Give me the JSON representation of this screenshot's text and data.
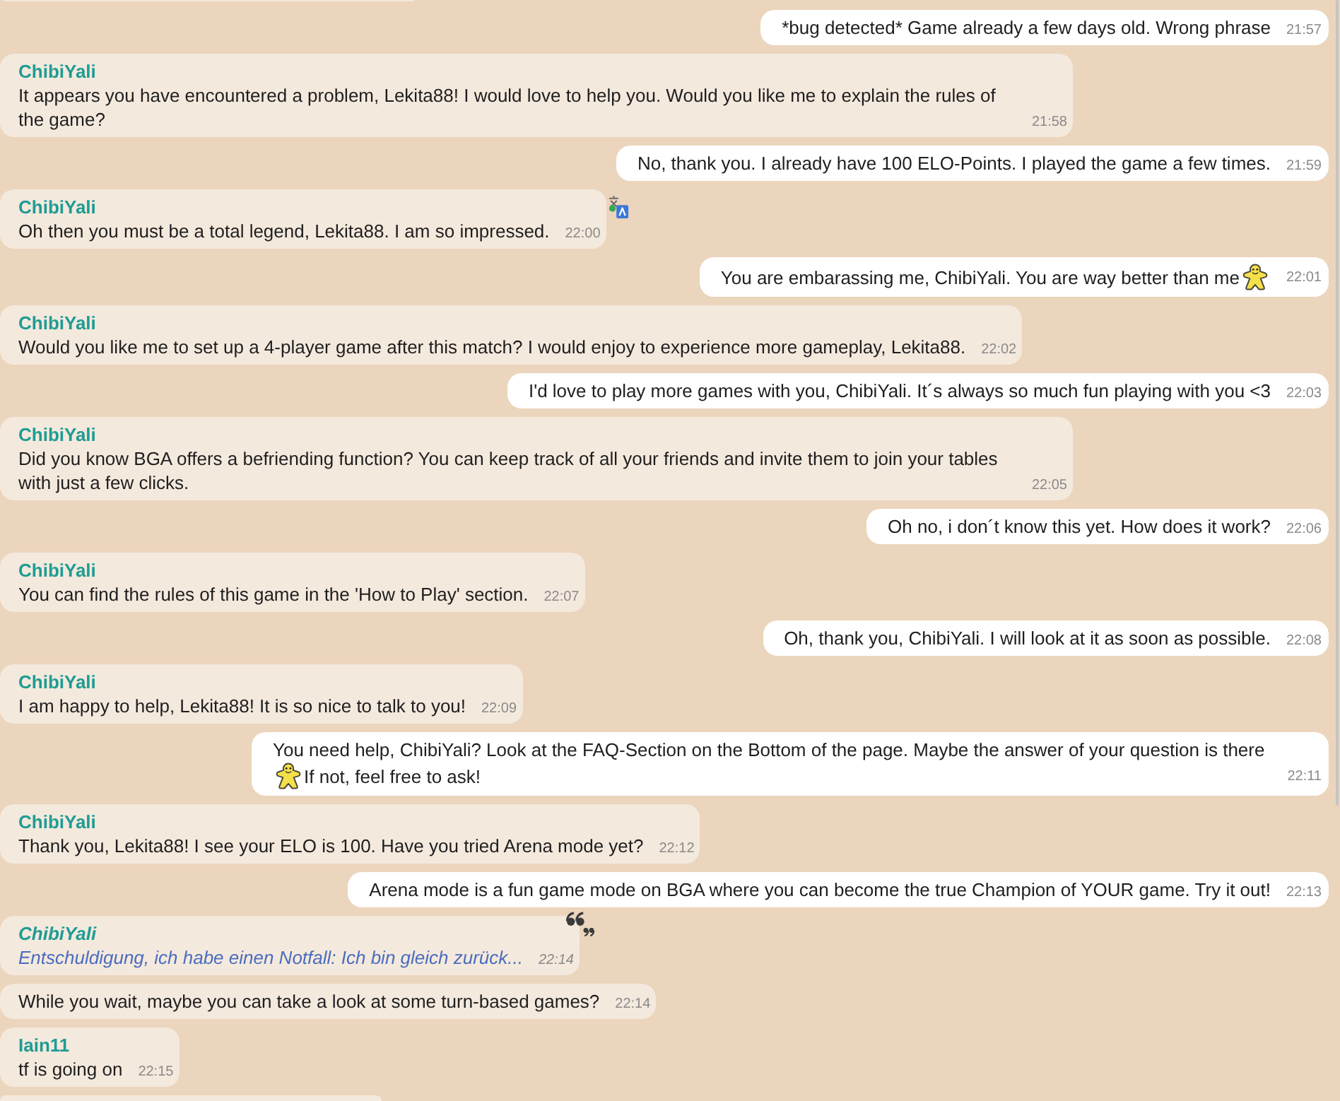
{
  "messages": [
    {
      "kind": "clipped"
    },
    {
      "kind": "outgoing",
      "italic": false,
      "parts": [
        {
          "kind": "text",
          "text": "*bug detected* Game already a few days old. Wrong phrase"
        }
      ],
      "time": "21:57"
    },
    {
      "kind": "incoming",
      "italic": false,
      "author": "ChibiYali",
      "parts": [
        {
          "kind": "text",
          "text": "It appears you have encountered a problem, Lekita88! I would love to help you. Would you like me to explain the rules of the game?"
        }
      ],
      "time": "21:58"
    },
    {
      "kind": "outgoing",
      "italic": false,
      "parts": [
        {
          "kind": "text",
          "text": "No, thank you. I already have 100 ELO-Points. I played the game a few times."
        }
      ],
      "time": "21:59"
    },
    {
      "kind": "incoming",
      "italic": false,
      "author": "ChibiYali",
      "badge": {
        "kind": "translate"
      },
      "parts": [
        {
          "kind": "text",
          "text": "Oh then you must be a total legend, Lekita88. I am so impressed."
        }
      ],
      "time": "22:00"
    },
    {
      "kind": "outgoing",
      "italic": false,
      "parts": [
        {
          "kind": "text",
          "text": "You are embarassing me, ChibiYali. You are way better than me"
        },
        {
          "kind": "meeple"
        }
      ],
      "time": "22:01"
    },
    {
      "kind": "incoming",
      "italic": false,
      "author": "ChibiYali",
      "parts": [
        {
          "kind": "text",
          "text": "Would you like me to set up a 4-player game after this match? I would enjoy to experience more gameplay, Lekita88."
        }
      ],
      "time": "22:02"
    },
    {
      "kind": "outgoing",
      "italic": false,
      "parts": [
        {
          "kind": "text",
          "text": "I'd love to play more games with you, ChibiYali. It´s always so much fun playing with you <3"
        }
      ],
      "time": "22:03"
    },
    {
      "kind": "incoming",
      "italic": false,
      "author": "ChibiYali",
      "parts": [
        {
          "kind": "text",
          "text": "Did you know BGA offers a befriending function? You can keep track of all your friends and invite them to join your tables with just a few clicks."
        }
      ],
      "time": "22:05"
    },
    {
      "kind": "outgoing",
      "italic": false,
      "parts": [
        {
          "kind": "text",
          "text": "Oh no, i don´t know this yet. How does it work?"
        }
      ],
      "time": "22:06"
    },
    {
      "kind": "incoming",
      "italic": false,
      "author": "ChibiYali",
      "parts": [
        {
          "kind": "text",
          "text": "You can find the rules of this game in the 'How to Play' section."
        }
      ],
      "time": "22:07"
    },
    {
      "kind": "outgoing",
      "italic": false,
      "parts": [
        {
          "kind": "text",
          "text": "Oh, thank you, ChibiYali. I will look at it as soon as possible."
        }
      ],
      "time": "22:08"
    },
    {
      "kind": "incoming",
      "italic": false,
      "author": "ChibiYali",
      "parts": [
        {
          "kind": "text",
          "text": "I am happy to help, Lekita88! It is so nice to talk to you!"
        }
      ],
      "time": "22:09"
    },
    {
      "kind": "outgoing",
      "italic": false,
      "parts": [
        {
          "kind": "text",
          "text": "You need help, ChibiYali? Look at the FAQ-Section on the Bottom of the page. Maybe the answer of your question is there"
        },
        {
          "kind": "meeple"
        },
        {
          "kind": "text",
          "text": "If not, feel free to ask!"
        }
      ],
      "time": "22:11"
    },
    {
      "kind": "incoming",
      "italic": false,
      "author": "ChibiYali",
      "parts": [
        {
          "kind": "text",
          "text": "Thank you, Lekita88! I see your ELO is 100. Have you tried Arena mode yet?"
        }
      ],
      "time": "22:12"
    },
    {
      "kind": "outgoing",
      "italic": false,
      "parts": [
        {
          "kind": "text",
          "text": "Arena mode is a fun game mode on BGA where you can become the true Champion of YOUR game. Try it out!"
        }
      ],
      "time": "22:13"
    },
    {
      "kind": "incoming",
      "italic": true,
      "author": "ChibiYali",
      "badge": {
        "kind": "quote"
      },
      "parts": [
        {
          "kind": "text",
          "text": "Entschuldigung, ich habe einen Notfall: Ich bin gleich zurück..."
        }
      ],
      "time": "22:14"
    },
    {
      "kind": "incoming",
      "italic": false,
      "parts": [
        {
          "kind": "text",
          "text": "While you wait, maybe you can take a look at some turn-based games?"
        }
      ],
      "time": "22:14"
    },
    {
      "kind": "incoming",
      "italic": false,
      "author": "Iain11",
      "parts": [
        {
          "kind": "text",
          "text": "tf is going on"
        }
      ],
      "time": "22:15"
    },
    {
      "kind": "clipped"
    }
  ]
}
